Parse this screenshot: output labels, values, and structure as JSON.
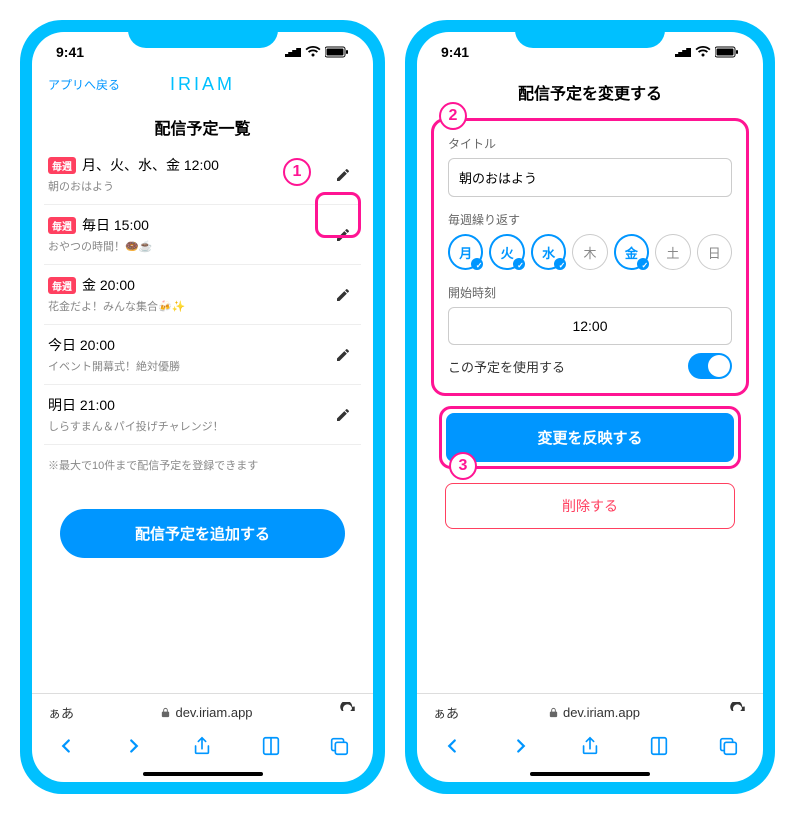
{
  "status": {
    "time": "9:41"
  },
  "left": {
    "back": "アプリへ戻る",
    "brand": "IRIAM",
    "title": "配信予定一覧",
    "items": [
      {
        "badge": "毎週",
        "title": "月、火、水、金 12:00",
        "sub": "朝のおはよう"
      },
      {
        "badge": "毎週",
        "title": "毎日 15:00",
        "sub": "おやつの時間！🍩☕"
      },
      {
        "badge": "毎週",
        "title": "金 20:00",
        "sub": "花金だよ！みんな集合🍻✨"
      },
      {
        "badge": "",
        "title": "今日 20:00",
        "sub": "イベント開幕式！絶対優勝"
      },
      {
        "badge": "",
        "title": "明日 21:00",
        "sub": "しらすまん＆パイ投げチャレンジ！"
      }
    ],
    "note": "※最大で10件まで配信予定を登録できます",
    "add_button": "配信予定を追加する"
  },
  "right": {
    "title": "配信予定を変更する",
    "title_label": "タイトル",
    "title_value": "朝のおはよう",
    "repeat_label": "毎週繰り返す",
    "days": [
      {
        "label": "月",
        "selected": true
      },
      {
        "label": "火",
        "selected": true
      },
      {
        "label": "水",
        "selected": true
      },
      {
        "label": "木",
        "selected": false
      },
      {
        "label": "金",
        "selected": true
      },
      {
        "label": "土",
        "selected": false
      },
      {
        "label": "日",
        "selected": false
      }
    ],
    "start_label": "開始時刻",
    "start_value": "12:00",
    "use_label": "この予定を使用する",
    "submit": "変更を反映する",
    "delete": "削除する"
  },
  "browser": {
    "aa": "ぁあ",
    "url": "dev.iriam.app"
  },
  "callouts": {
    "c1": "1",
    "c2": "2",
    "c3": "3"
  }
}
